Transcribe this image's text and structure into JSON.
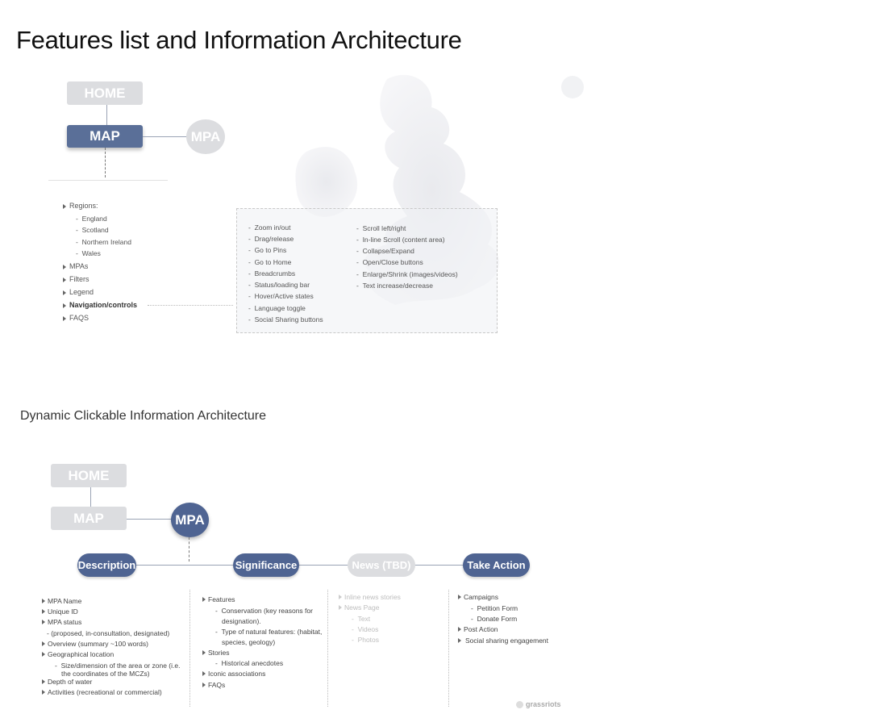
{
  "page_title": "Features list and Information Architecture",
  "section_title": "Dynamic Clickable Information Architecture",
  "top_diagram": {
    "home": "HOME",
    "map": "MAP",
    "mpa": "MPA",
    "list": [
      {
        "label": "Regions:",
        "children": [
          "England",
          "Scotland",
          "Northern Ireland",
          "Wales"
        ]
      },
      {
        "label": "MPAs"
      },
      {
        "label": "Filters"
      },
      {
        "label": "Legend"
      },
      {
        "label": "Navigation/controls"
      },
      {
        "label": "FAQS"
      }
    ],
    "controls_left": [
      "Zoom in/out",
      "Drag/release",
      "Go to Pins",
      "Go to Home",
      "Breadcrumbs",
      "Status/loading bar",
      "Hover/Active states",
      "Language toggle",
      "Social Sharing buttons"
    ],
    "controls_right": [
      "Scroll left/right",
      "In-line Scroll (content area)",
      "Collapse/Expand",
      "Open/Close buttons",
      "Enlarge/Shrink (images/videos)",
      "Text increase/decrease"
    ]
  },
  "bottom_diagram": {
    "home": "HOME",
    "map": "MAP",
    "mpa": "MPA",
    "nodes": [
      "Description",
      "Significance",
      "News (TBD)",
      "Take Action"
    ],
    "description": {
      "items": [
        "MPA Name",
        "Unique ID",
        "MPA status",
        "- (proposed, in-consultation, designated)",
        "Overview (summary ~100 words)",
        "Geographical location",
        "Size/dimension of the area or zone (i.e.",
        "the coordinates of the MCZs)",
        "Depth of water",
        "Activities (recreational or commercial)"
      ]
    },
    "significance": {
      "items": [
        "Features",
        "Conservation (key reasons for",
        "designation).",
        "Type of natural features: (habitat,",
        "species, geology)",
        "Stories",
        "Historical anecdotes",
        "Iconic associations",
        "FAQs"
      ]
    },
    "news": {
      "items": [
        "Inline news stories",
        "News Page",
        "Text",
        "Videos",
        "Photos"
      ]
    },
    "take_action": {
      "items": [
        "Campaigns",
        "Petition Form",
        "Donate Form",
        "Post Action",
        "Social sharing engagement"
      ]
    }
  },
  "watermark": "grassriots"
}
